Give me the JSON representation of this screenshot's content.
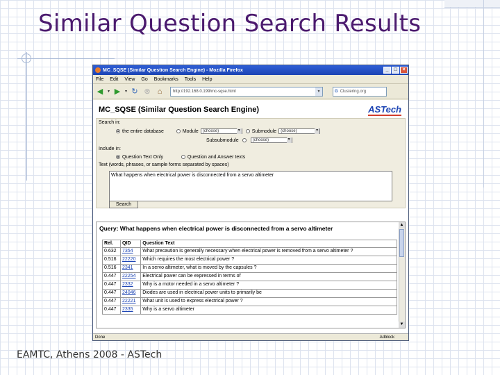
{
  "slide": {
    "title": "Similar Question Search Results",
    "footer": "EAMTC, Athens 2008 - ASTech"
  },
  "browser": {
    "window_title": "MC_SQSE (Similar Question Search Engine) - Mozilla Firefox",
    "menu": [
      "File",
      "Edit",
      "View",
      "Go",
      "Bookmarks",
      "Tools",
      "Help"
    ],
    "url": "http://192.168.0.199/mc-sqse.html",
    "search_placeholder": "Clustering.org",
    "status_left": "Done",
    "status_right": "Adblock"
  },
  "page": {
    "app_title": "MC_SQSE (Similar Question Search Engine)",
    "logo": "ASTech",
    "search_in_label": "Search in:",
    "option_entire": "the entire database",
    "module_label": "Module",
    "module_value": "(choose)",
    "submodule_label": "Submodule",
    "submodule_value": "(choose)",
    "subsubmodule_label": "Subsubmodule",
    "subsubmodule_value": "(choose)",
    "include_label": "Include in:",
    "option_text_only": "Question Text Only",
    "option_text_answers": "Question and Answer texts",
    "text_hint": "Text (words, phrases, or sample forms separated by spaces)",
    "query_text": "What happens when electrical power is disconnected from a servo altimeter",
    "search_button": "Search"
  },
  "results": {
    "query_line": "Query: What happens when electrical power is disconnected from a servo altimeter",
    "headers": [
      "Rel.",
      "QID",
      "Question Text"
    ],
    "rows": [
      {
        "rel": "0.632",
        "qid": "7354",
        "text": "What precaution is generally necessary when electrical power is removed from a servo altimeter ?"
      },
      {
        "rel": "0.516",
        "qid": "22220",
        "text": "Which requires the most electrical power ?"
      },
      {
        "rel": "0.516",
        "qid": "2341",
        "text": "In a servo altimeter, what is moved by the capsules ?"
      },
      {
        "rel": "0.447",
        "qid": "22254",
        "text": "Electrical power can be expressed in terms of"
      },
      {
        "rel": "0.447",
        "qid": "2332",
        "text": "Why is a motor needed in a servo altimeter ?"
      },
      {
        "rel": "0.447",
        "qid": "24046",
        "text": "Diodes are used in electrical power units to primarily be"
      },
      {
        "rel": "0.447",
        "qid": "22221",
        "text": "What unit is used to express electrical power ?"
      },
      {
        "rel": "0.447",
        "qid": "2335",
        "text": "Why is a servo altimeter"
      }
    ]
  }
}
